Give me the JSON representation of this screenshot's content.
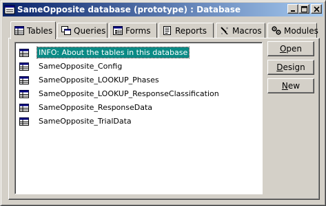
{
  "window": {
    "title": "SameOpposite database (prototype) : Database",
    "icon": "database-window-icon"
  },
  "titlebar_buttons": [
    {
      "name": "minimize-button",
      "icon": "minimize-icon"
    },
    {
      "name": "maximize-button",
      "icon": "maximize-icon"
    },
    {
      "name": "close-button",
      "icon": "close-icon"
    }
  ],
  "tabs": [
    {
      "label": "Tables",
      "icon": "table-icon",
      "active": true
    },
    {
      "label": "Queries",
      "icon": "query-icon",
      "active": false
    },
    {
      "label": "Forms",
      "icon": "form-icon",
      "active": false
    },
    {
      "label": "Reports",
      "icon": "report-icon",
      "active": false
    },
    {
      "label": "Macros",
      "icon": "macro-icon",
      "active": false
    },
    {
      "label": "Modules",
      "icon": "module-icon",
      "active": false
    }
  ],
  "tables": [
    {
      "label": "INFO: About the tables in this database",
      "selected": true
    },
    {
      "label": "SameOpposite_Config",
      "selected": false
    },
    {
      "label": "SameOpposite_LOOKUP_Phases",
      "selected": false
    },
    {
      "label": "SameOpposite_LOOKUP_ResponseClassification",
      "selected": false
    },
    {
      "label": "SameOpposite_ResponseData",
      "selected": false
    },
    {
      "label": "SameOpposite_TrialData",
      "selected": false
    }
  ],
  "buttons": {
    "open": {
      "label": "Open",
      "underline": "O",
      "rest": "pen"
    },
    "design": {
      "label": "Design",
      "underline": "D",
      "rest": "esign"
    },
    "new": {
      "label": "New",
      "underline": "N",
      "rest": "ew"
    }
  },
  "colors": {
    "selection": "#0a8a85",
    "titlebar_start": "#0a246a",
    "titlebar_end": "#a6caf0",
    "face": "#d4d0c8"
  }
}
